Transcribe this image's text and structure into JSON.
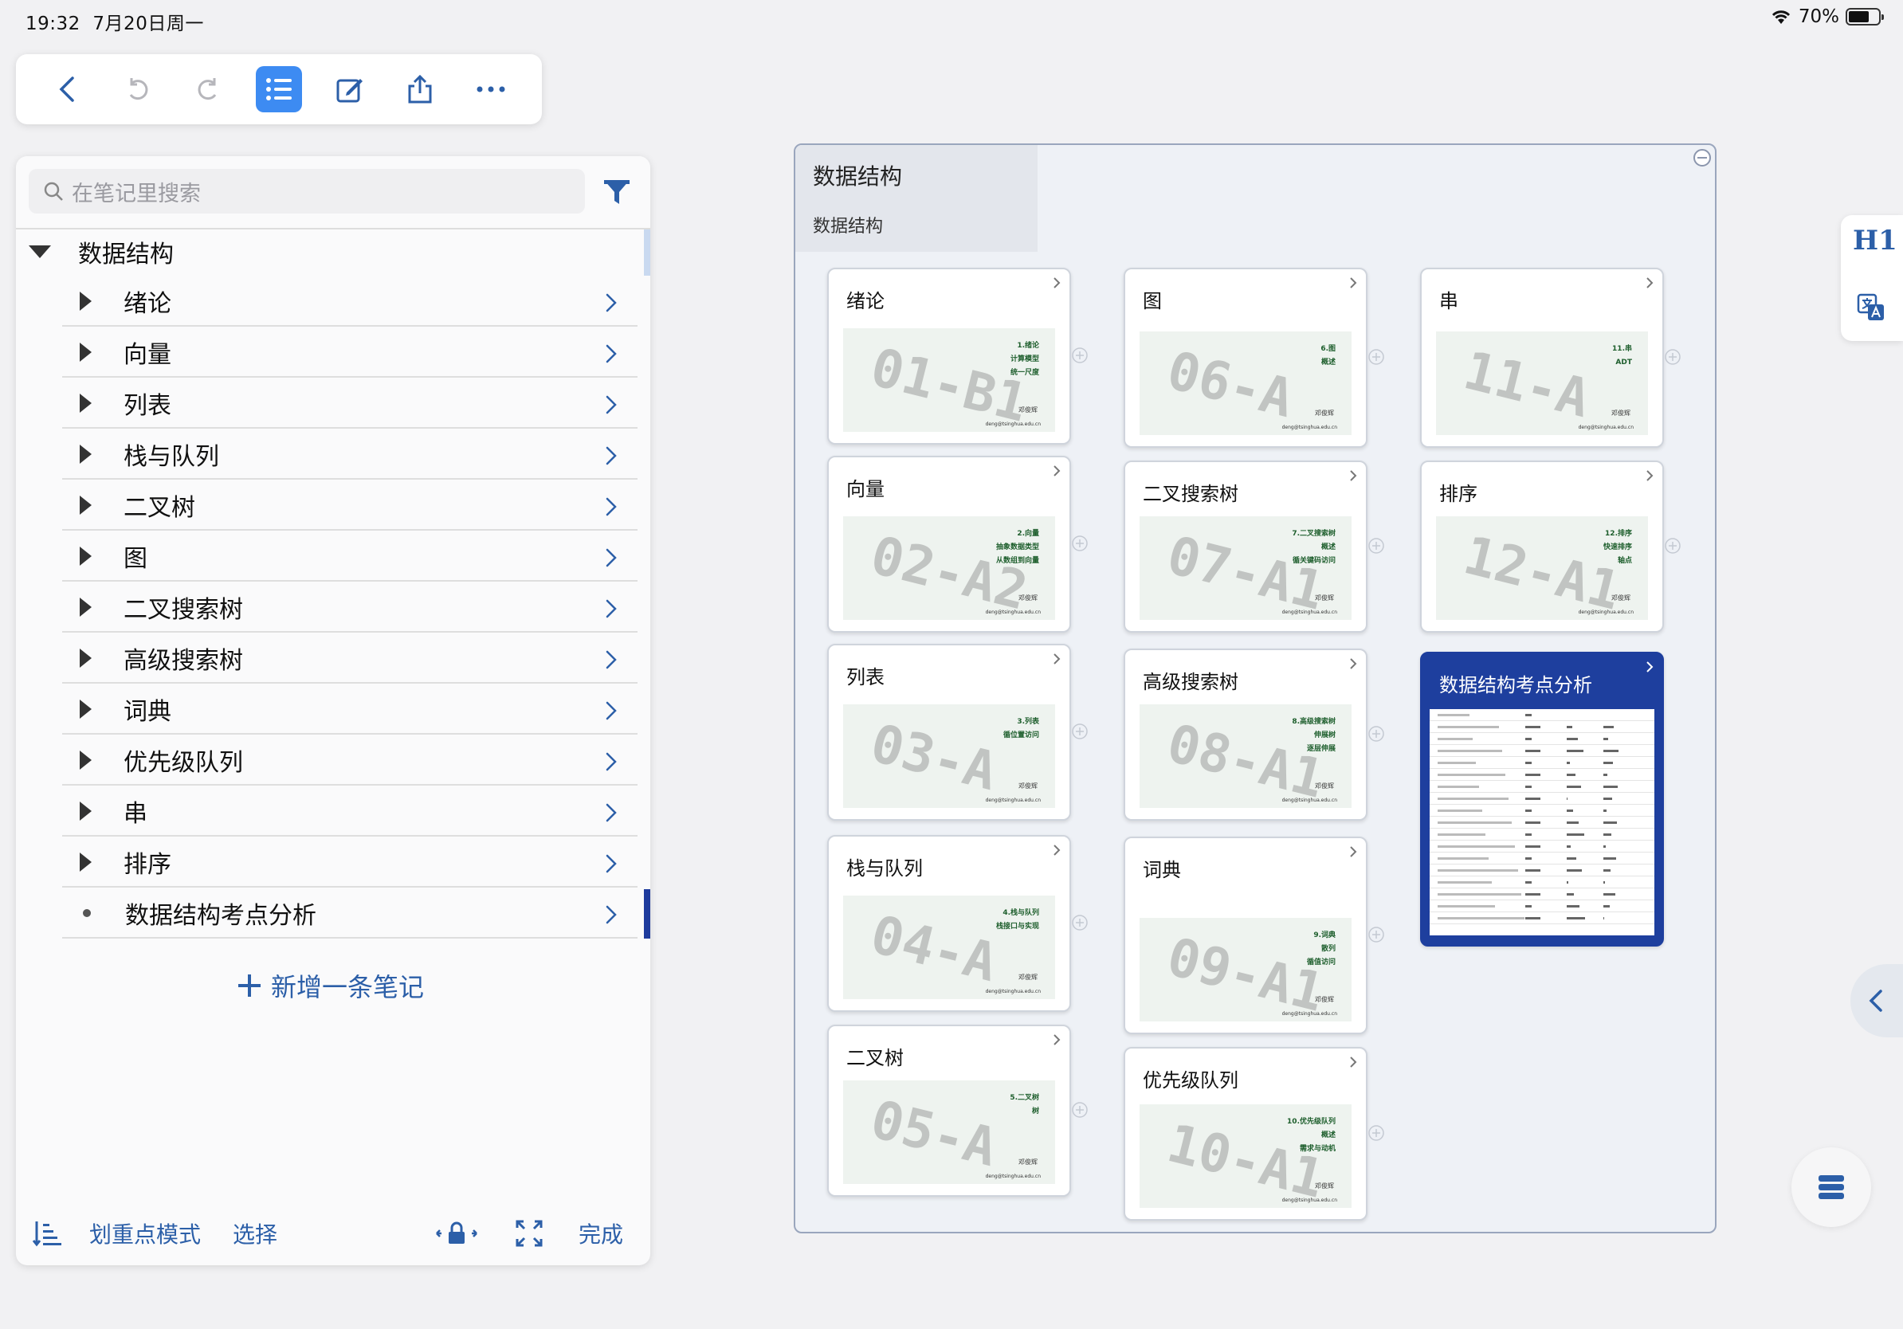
{
  "status": {
    "time": "19:32",
    "date": "7月20日周一",
    "battery": "70%",
    "battery_level": 0.7
  },
  "toolbar": {
    "icons": [
      "back-icon",
      "undo-icon",
      "redo-icon",
      "outline-list-icon",
      "edit-icon",
      "share-icon",
      "more-icon"
    ]
  },
  "sidebar": {
    "search_placeholder": "在笔记里搜索",
    "root": "数据结构",
    "items": [
      {
        "label": "绪论"
      },
      {
        "label": "向量"
      },
      {
        "label": "列表"
      },
      {
        "label": "栈与队列"
      },
      {
        "label": "二叉树"
      },
      {
        "label": "图"
      },
      {
        "label": "二叉搜索树"
      },
      {
        "label": "高级搜索树"
      },
      {
        "label": "词典"
      },
      {
        "label": "优先级队列"
      },
      {
        "label": "串"
      },
      {
        "label": "排序"
      },
      {
        "label": "数据结构考点分析"
      }
    ],
    "add_note": "新增一条笔记",
    "bottom": {
      "mark_mode": "划重点模式",
      "select": "选择",
      "done": "完成"
    }
  },
  "mindmap": {
    "title": "数据结构",
    "subtitle": "数据结构",
    "cards": [
      {
        "title": "绪论",
        "watermark": "01-B1",
        "slide_title": "1.绪论",
        "slide_lines": [
          "计算模型",
          "统一尺度"
        ]
      },
      {
        "title": "向量",
        "watermark": "02-A2",
        "slide_title": "2.向量",
        "slide_lines": [
          "抽象数据类型",
          "从数组到向量"
        ]
      },
      {
        "title": "列表",
        "watermark": "03-A",
        "slide_title": "3.列表",
        "slide_lines": [
          "循位置访问"
        ]
      },
      {
        "title": "栈与队列",
        "watermark": "04-A",
        "slide_title": "4.栈与队列",
        "slide_lines": [
          "栈接口与实现"
        ]
      },
      {
        "title": "二叉树",
        "watermark": "05-A",
        "slide_title": "5.二叉树",
        "slide_lines": [
          "树"
        ]
      },
      {
        "title": "图",
        "watermark": "06-A",
        "slide_title": "6.图",
        "slide_lines": [
          "概述"
        ]
      },
      {
        "title": "二叉搜索树",
        "watermark": "07-A1",
        "slide_title": "7.二叉搜索树",
        "slide_lines": [
          "概述",
          "循关键码访问"
        ]
      },
      {
        "title": "高级搜索树",
        "watermark": "08-A1",
        "slide_title": "8.高级搜索树",
        "slide_lines": [
          "伸展树",
          "逐层伸展"
        ]
      },
      {
        "title": "词典",
        "watermark": "09-A1",
        "slide_title": "9.词典",
        "slide_lines": [
          "散列",
          "循值访问"
        ]
      },
      {
        "title": "优先级队列",
        "watermark": "10-A1",
        "slide_title": "10.优先级队列",
        "slide_lines": [
          "概述",
          "需求与动机"
        ]
      },
      {
        "title": "串",
        "watermark": "11-A",
        "slide_title": "11.串",
        "slide_lines": [
          "ADT"
        ]
      },
      {
        "title": "排序",
        "watermark": "12-A1",
        "slide_title": "12.排序",
        "slide_lines": [
          "快速排序",
          "轴点"
        ]
      },
      {
        "title": "数据结构考点分析",
        "watermark": "",
        "slide_title": "",
        "slide_lines": []
      }
    ],
    "signature": "邓俊辉",
    "email": "deng@tsinghua.edu.cn"
  },
  "right": {
    "h1_label": "H1"
  }
}
